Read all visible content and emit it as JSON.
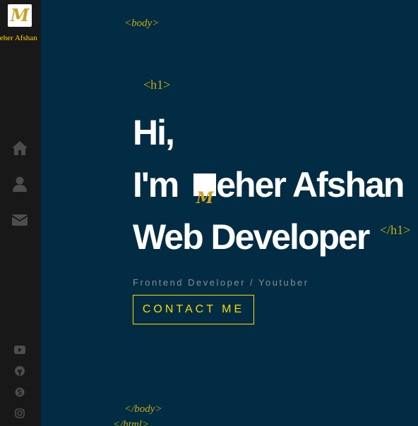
{
  "brand": {
    "logo_letter": "M",
    "name": "Meher Afshan"
  },
  "nav": {
    "items": [
      {
        "icon": "home-icon"
      },
      {
        "icon": "user-icon"
      },
      {
        "icon": "envelope-icon"
      }
    ]
  },
  "social": {
    "items": [
      {
        "icon": "youtube-icon"
      },
      {
        "icon": "github-icon"
      },
      {
        "icon": "skype-icon"
      },
      {
        "icon": "instagram-icon"
      }
    ]
  },
  "tags": {
    "body_open": "<body>",
    "h1_open": "<h1>",
    "h1_close": "</h1>",
    "body_close": "</body>",
    "html_close": "</html>"
  },
  "hero": {
    "line1": "Hi,",
    "line2_prefix": "I'm",
    "line2_logo": "M",
    "line2_rest": "eher Afshan",
    "line3": "Web Developer",
    "subtitle": "Frontend Developer / Youtuber",
    "contact_label": "CONTACT ME"
  },
  "colors": {
    "background": "#022c43",
    "sidebar": "#181818",
    "accent": "#ffd700",
    "subtitle": "#8d8d8d"
  }
}
